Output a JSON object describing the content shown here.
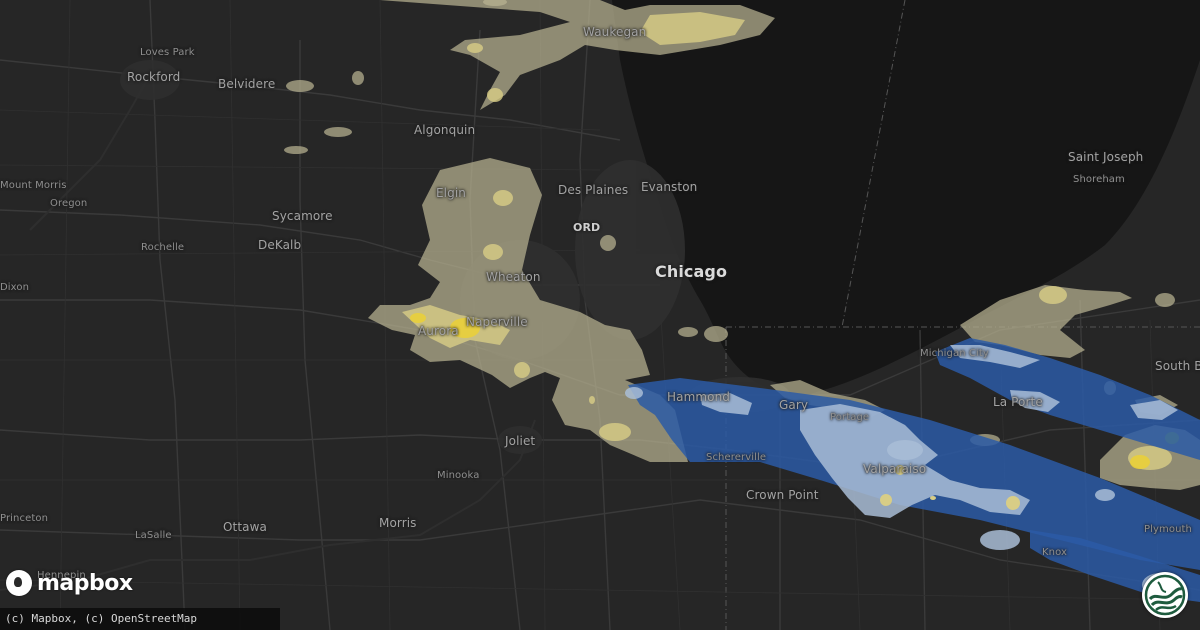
{
  "places": [
    {
      "name": "Waukegan",
      "type": "town"
    },
    {
      "name": "Loves Park",
      "type": "small"
    },
    {
      "name": "Rockford",
      "type": "town"
    },
    {
      "name": "Belvidere",
      "type": "town"
    },
    {
      "name": "Algonquin",
      "type": "town"
    },
    {
      "name": "Mount Morris",
      "type": "small"
    },
    {
      "name": "Oregon",
      "type": "small"
    },
    {
      "name": "Sycamore",
      "type": "town"
    },
    {
      "name": "DeKalb",
      "type": "town"
    },
    {
      "name": "Rochelle",
      "type": "small"
    },
    {
      "name": "Dixon",
      "type": "small"
    },
    {
      "name": "Elgin",
      "type": "town"
    },
    {
      "name": "Des Plaines",
      "type": "town"
    },
    {
      "name": "Evanston",
      "type": "town"
    },
    {
      "name": "ORD",
      "type": "airport"
    },
    {
      "name": "Chicago",
      "type": "city"
    },
    {
      "name": "Wheaton",
      "type": "town"
    },
    {
      "name": "Aurora",
      "type": "town"
    },
    {
      "name": "Naperville",
      "type": "town"
    },
    {
      "name": "Joliet",
      "type": "town"
    },
    {
      "name": "Minooka",
      "type": "small"
    },
    {
      "name": "Hammond",
      "type": "town"
    },
    {
      "name": "Gary",
      "type": "town"
    },
    {
      "name": "Portage",
      "type": "small"
    },
    {
      "name": "Schererville",
      "type": "small"
    },
    {
      "name": "Crown Point",
      "type": "town"
    },
    {
      "name": "Valparaiso",
      "type": "town"
    },
    {
      "name": "Princeton",
      "type": "small"
    },
    {
      "name": "LaSalle",
      "type": "small"
    },
    {
      "name": "Ottawa",
      "type": "town"
    },
    {
      "name": "Morris",
      "type": "town"
    },
    {
      "name": "Hennepin",
      "type": "small"
    },
    {
      "name": "Saint Joseph",
      "type": "town"
    },
    {
      "name": "Shoreham",
      "type": "small"
    },
    {
      "name": "Michigan City",
      "type": "small"
    },
    {
      "name": "La Porte",
      "type": "town"
    },
    {
      "name": "South Bend",
      "type": "town"
    },
    {
      "name": "Knox",
      "type": "small"
    },
    {
      "name": "Plymouth",
      "type": "small"
    }
  ],
  "logo": {
    "wordmark": "mapbox",
    "icon": "mapbox-logo-icon"
  },
  "attribution": "(c) Mapbox, (c) OpenStreetMap",
  "badge": {
    "icon": "weather-globe-icon"
  },
  "colors": {
    "land": "#262626",
    "lake": "#161616",
    "rain_light": "#b9b392",
    "rain_moderate": "#d8cd86",
    "rain_heavy": "#e9cf3a",
    "hail_swath": "#2c5aa6",
    "hail_core": "#a9bdd6"
  }
}
